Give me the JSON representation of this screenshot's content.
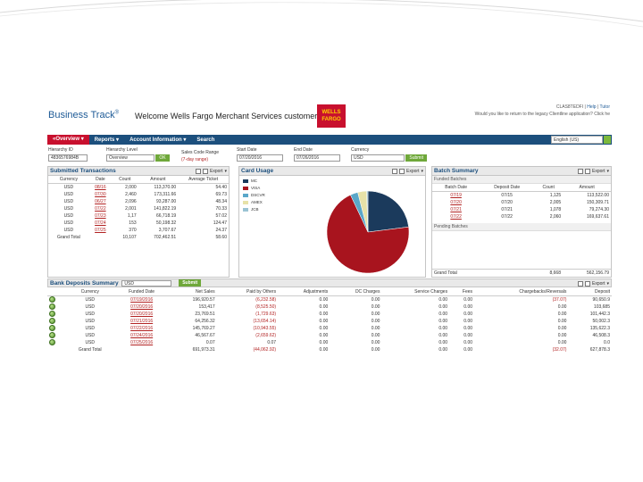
{
  "colors": {
    "nav": "#1c4f7d",
    "accent": "#c8102e",
    "go": "#6fa83a",
    "link": "#b22222"
  },
  "header": {
    "logo": "Business Track",
    "logo_mark": "®",
    "welcome": "Welcome Wells Fargo Merchant Services customers",
    "wf_line1": "WELLS",
    "wf_line2": "FARGO",
    "top_right_line1_a": "CLAS8TEDFI | ",
    "top_right_help": "Help",
    "top_right_sep": " | ",
    "top_right_tutor": "Tutor",
    "top_right_line2": "Would you like to return to the legacy Clientline application? Click he"
  },
  "nav": {
    "items": [
      "«Overview ▾",
      "Reports ▾",
      "Account Information ▾",
      "Search"
    ],
    "language": "English (US)"
  },
  "filters": {
    "hierarchy_id_label": "Hierarchy ID",
    "hierarchy_id_value": "4836576984B",
    "hierarchy_level_label": "Hierarchy Level",
    "hierarchy_level_value": "Overview",
    "ok": "OK",
    "sales_code_label": "Sales Code Range",
    "sales_code_hint": "(7-day range)",
    "start_date_label": "Start Date",
    "start_date_value": "07/20/2016",
    "end_date_label": "End Date",
    "end_date_value": "07/26/2016",
    "currency_label": "Currency",
    "currency_value": "USD",
    "submit": "Submit"
  },
  "submitted": {
    "title": "Submitted Transactions",
    "export": "Export",
    "columns": [
      "Currency",
      "Date",
      "Count",
      "Amount",
      "Average Ticket"
    ],
    "rows": [
      [
        "USD",
        "08/16",
        "2,000",
        "113,370.00",
        "54.40"
      ],
      [
        "USD",
        "07/30",
        "2,460",
        "173,311.66",
        "69.73"
      ],
      [
        "USD",
        "06/27",
        "2,096",
        "93,287.00",
        "48.34"
      ],
      [
        "USD",
        "07/22",
        "2,001",
        "141,822.19",
        "70.33"
      ],
      [
        "USD",
        "07/23",
        "1,17",
        "66,718.19",
        "57.02"
      ],
      [
        "USD",
        "07/24",
        "153",
        "50,198.32",
        "124.47"
      ],
      [
        "USD",
        "07/25",
        "370",
        "3,707.67",
        "24.37"
      ]
    ],
    "total": [
      "Grand Total",
      "",
      "10,107",
      "702,462.51",
      "58.60"
    ]
  },
  "card_usage": {
    "title": "Card Usage",
    "export": "Export",
    "legend": [
      "MC",
      "VISA",
      "DSCVR",
      "AMEX",
      "JCB"
    ]
  },
  "chart_data": {
    "type": "pie",
    "title": "Card Usage",
    "categories": [
      "MC",
      "VISA",
      "DSCVR",
      "AMEX",
      "JCB"
    ],
    "values": [
      23,
      70,
      3,
      3.5,
      0.5
    ],
    "colors": [
      "#1b3a5c",
      "#a8141e",
      "#5aa7c9",
      "#e7e2a8",
      "#9ac3d3"
    ]
  },
  "batch": {
    "title": "Batch Summary",
    "export": "Export",
    "funded_label": "Funded Batches",
    "columns": [
      "Batch Date",
      "Deposit Date",
      "Count",
      "Amount"
    ],
    "rows": [
      [
        "07/19",
        "07/15",
        "1,125",
        "113,522.00"
      ],
      [
        "07/20",
        "07/20",
        "2,005",
        "150,309.71"
      ],
      [
        "07/21",
        "07/21",
        "1,078",
        "79,274.30"
      ],
      [
        "07/22",
        "07/22",
        "2,060",
        "169,637.61"
      ]
    ],
    "pending_label": "Pending Batches",
    "grand_total_label": "Grand Total",
    "grand_total_count": "8,668",
    "grand_total_amount": "562,156.79"
  },
  "deposits": {
    "title": "Bank Deposits Summary",
    "currency": "USD",
    "submit": "Submit",
    "export": "Export",
    "columns": [
      "",
      "Currency",
      "Funded Date",
      "Net Sales",
      "Paid by Others",
      "Adjustments",
      "DC Charges",
      "Service Charges",
      "Fees",
      "Chargebacks/Reversals",
      "Deposit"
    ],
    "rows": [
      [
        "USD",
        "07/19/2016",
        "196,920.57",
        "(6,232.58)",
        "0.00",
        "0.00",
        "0.00",
        "0.00",
        "(37.07)",
        "90,650.9"
      ],
      [
        "USD",
        "07/20/2016",
        "153,417",
        "(8,525.50)",
        "0.00",
        "0.00",
        "0.00",
        "0.00",
        "0.00",
        "103,685"
      ],
      [
        "USD",
        "07/20/2016",
        "23,769.51",
        "(1,729.63)",
        "0.00",
        "0.00",
        "0.00",
        "0.00",
        "0.00",
        "101,442.3"
      ],
      [
        "USD",
        "07/21/2016",
        "64,256.32",
        "(13,654.14)",
        "0.00",
        "0.00",
        "0.00",
        "0.00",
        "0.00",
        "50,002.3"
      ],
      [
        "USD",
        "07/22/2016",
        "145,769.27",
        "(10,943.55)",
        "0.00",
        "0.00",
        "0.00",
        "0.00",
        "0.00",
        "135,622.3"
      ],
      [
        "USD",
        "07/24/2016",
        "46,567.67",
        "(2,659.62)",
        "0.00",
        "0.00",
        "0.00",
        "0.00",
        "0.00",
        "46,508.3"
      ],
      [
        "USD",
        "07/25/2016",
        "0.07",
        "0.07",
        "0.00",
        "0.00",
        "0.00",
        "0.00",
        "0.00",
        "0.0"
      ]
    ],
    "total": [
      "Grand Total",
      "",
      "691,973.31",
      "(44,062.92)",
      "0.00",
      "0.00",
      "0.00",
      "0.00",
      "(32.07)",
      "627,878.3"
    ]
  }
}
